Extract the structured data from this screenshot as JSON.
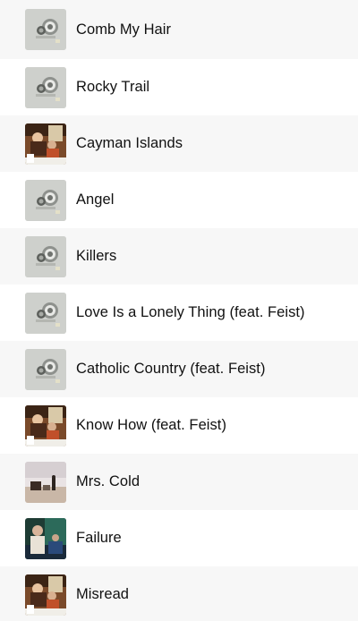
{
  "tracks": [
    {
      "title": "Comb My Hair",
      "art": "speaker-art"
    },
    {
      "title": "Rocky Trail",
      "art": "speaker-art"
    },
    {
      "title": "Cayman Islands",
      "art": "band-art"
    },
    {
      "title": "Angel",
      "art": "speaker-art"
    },
    {
      "title": "Killers",
      "art": "speaker-art"
    },
    {
      "title": "Love Is a Lonely Thing (feat. Feist)",
      "art": "speaker-art"
    },
    {
      "title": "Catholic Country (feat. Feist)",
      "art": "speaker-art"
    },
    {
      "title": "Know How (feat. Feist)",
      "art": "band-art"
    },
    {
      "title": "Mrs. Cold",
      "art": "beach-art"
    },
    {
      "title": "Failure",
      "art": "portrait-art"
    },
    {
      "title": "Misread",
      "art": "band-art"
    }
  ]
}
